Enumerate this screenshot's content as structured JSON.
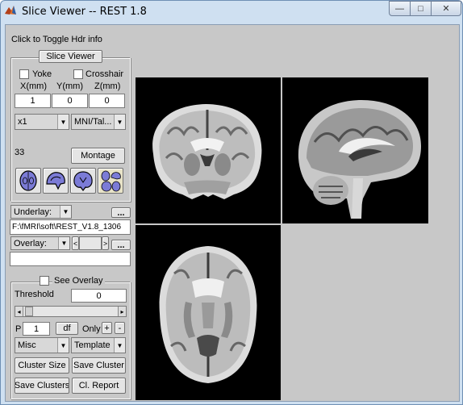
{
  "window": {
    "title": "Slice Viewer -- REST 1.8",
    "min_symbol": "—",
    "max_symbol": "□",
    "close_symbol": "✕"
  },
  "header_toggle": "Click to Toggle Hdr info",
  "slice_viewer": {
    "title": "Slice Viewer",
    "yoke_label": "Yoke",
    "crosshair_label": "Crosshair",
    "x_label": "X(mm)",
    "y_label": "Y(mm)",
    "z_label": "Z(mm)",
    "x_value": "1",
    "y_value": "0",
    "z_value": "0",
    "zoom_select": "x1",
    "space_select": "MNI/Tal...",
    "slice_number": "33",
    "montage_label": "Montage"
  },
  "underlay": {
    "label": "Underlay:",
    "browse_label": "...",
    "path": "F:\\fMRI\\soft\\REST_V1.8_1306"
  },
  "overlay": {
    "label": "Overlay:",
    "browse_label": "...",
    "prev_symbol": "<",
    "next_symbol": ">",
    "path": ""
  },
  "cluster_panel": {
    "see_overlay_label": "See Overlay",
    "threshold_label": "Threshold",
    "threshold_value": "0",
    "slider_left_symbol": "◂",
    "slider_right_symbol": "▸",
    "p_label": "P",
    "p_value": "1",
    "df_label": "df",
    "only_label": "Only",
    "plus_label": "+",
    "minus_label": "-",
    "misc_select": "Misc",
    "template_select": "Template",
    "cluster_size_label": "Cluster Size",
    "save_cluster_label": "Save Cluster",
    "save_clusters_label": "Save Clusters",
    "cl_report_label": "Cl. Report"
  },
  "colors": {
    "titlebar": "#cfe0f1",
    "client": "#c8c8c8",
    "view_icon": "#7b7bd6"
  }
}
